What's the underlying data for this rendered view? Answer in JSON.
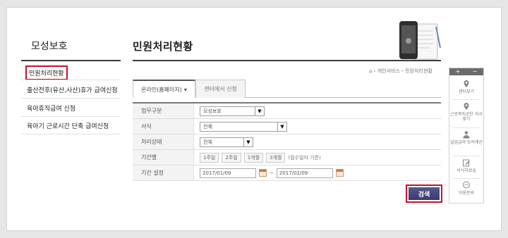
{
  "sidebar": {
    "title": "모성보호",
    "items": [
      {
        "label": "민원처리현황"
      },
      {
        "label": "출산전후(유산,사산)휴가 급여신청"
      },
      {
        "label": "육아휴직급여 신청"
      },
      {
        "label": "육아기 근로시간 단축 급여신청"
      }
    ]
  },
  "main": {
    "title": "민원처리현황",
    "breadcrumb": {
      "home_icon": "home-icon",
      "path": "개인서비스",
      "current": "민원처리현황"
    },
    "tabs": [
      {
        "label": "온라인(홈페이지)",
        "arrow": "▾"
      },
      {
        "label": "센터에서 신청"
      }
    ],
    "form": {
      "task_type": {
        "label": "업무구분",
        "value": "모성보호"
      },
      "form_name": {
        "label": "서식",
        "value": "전체"
      },
      "status": {
        "label": "처리상태",
        "value": "전체"
      },
      "period": {
        "label": "기간별",
        "options": [
          "1주일",
          "2주일",
          "1개월",
          "3개월"
        ],
        "note": "(접수일자 기준)"
      },
      "period_set": {
        "label": "기간 설정",
        "from": "2017/01/09",
        "sep": "~",
        "to": "2017/02/09"
      }
    },
    "search_label": "검색"
  },
  "quick_menu": {
    "plus": "+",
    "minus": "−",
    "items": [
      {
        "label": "센터찾기",
        "icon": "map-pin-icon"
      },
      {
        "label": "근로복지공단 지사찾기",
        "icon": "map-pin-icon"
      },
      {
        "label": "실업급여 모의계산",
        "icon": "person-icon"
      },
      {
        "label": "서식자료실",
        "icon": "pencil-icon"
      },
      {
        "label": "이용문의",
        "icon": "chat-icon"
      }
    ]
  },
  "colors": {
    "accent": "#4b4a80",
    "highlight": "#c8102e"
  }
}
